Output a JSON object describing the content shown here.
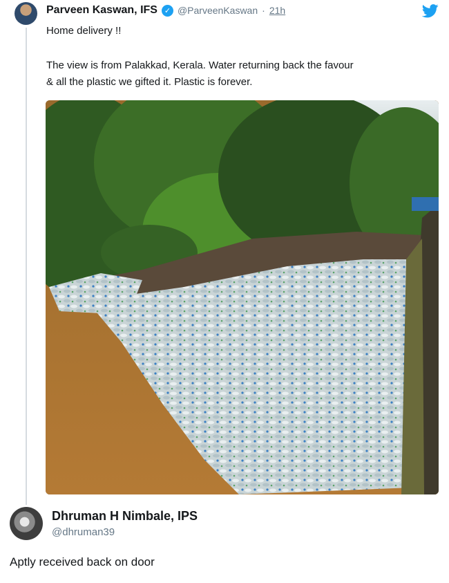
{
  "tweet": {
    "author_name": "Parveen Kaswan, IFS",
    "handle": "@ParveenKaswan",
    "separator": "·",
    "time": "21h",
    "line1": "Home delivery !!",
    "line2": "The view is from Palakkad, Kerala. Water returning back the favour",
    "line3": "& all the plastic we gifted it. Plastic is forever.",
    "verified_icon": "✓",
    "photo_alt": "river clogged with plastic bottles"
  },
  "reply": {
    "author_name": "Dhruman H Nimbale, IPS",
    "handle": "@dhruman39",
    "text": "Aptly received back on door"
  },
  "colors": {
    "twitter_blue": "#1da1f2",
    "muted": "#657786"
  }
}
